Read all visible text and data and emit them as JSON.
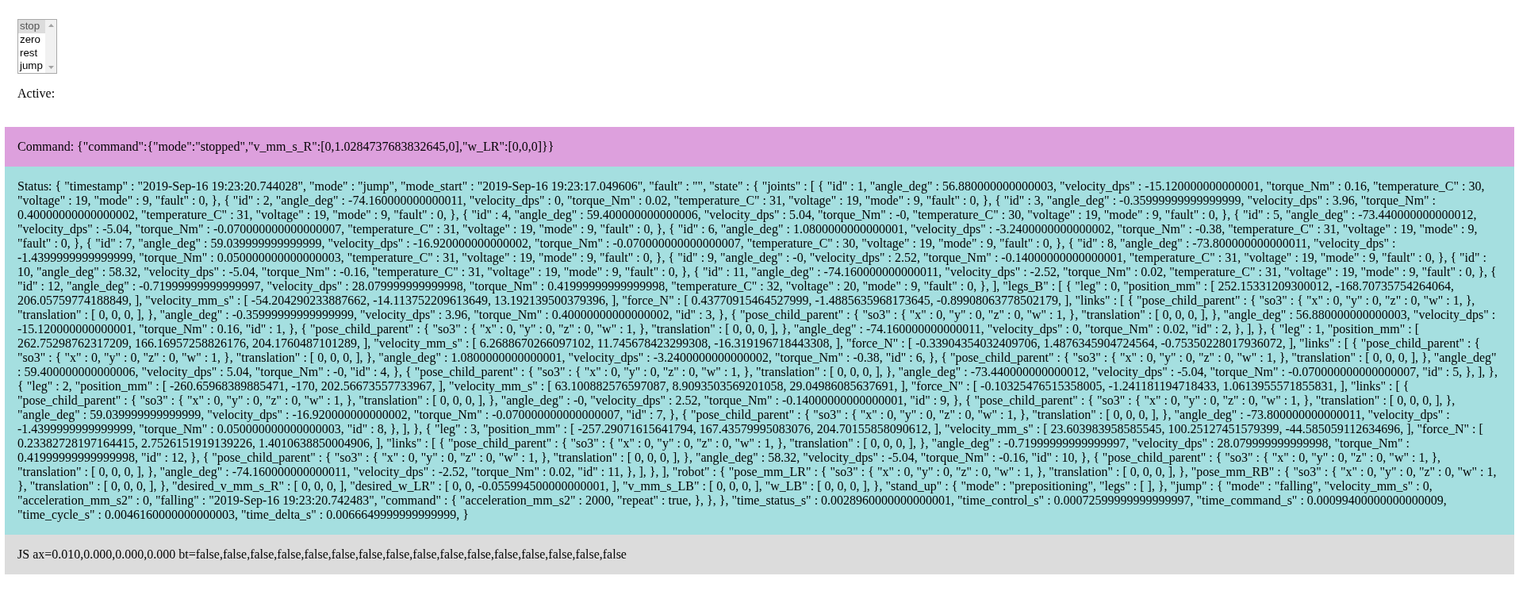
{
  "select": {
    "options": [
      {
        "label": "stop",
        "selected": true
      },
      {
        "label": "zero",
        "selected": false
      },
      {
        "label": "rest",
        "selected": false
      },
      {
        "label": "jump",
        "selected": false
      }
    ]
  },
  "active": {
    "label": "Active:"
  },
  "command_panel": {
    "text": "Command: {\"command\":{\"mode\":\"stopped\",\"v_mm_s_R\":[0,1.0284737683832645,0],\"w_LR\":[0,0,0]}}"
  },
  "status_panel": {
    "text": "Status: { \"timestamp\" : \"2019-Sep-16 19:23:20.744028\", \"mode\" : \"jump\", \"mode_start\" : \"2019-Sep-16 19:23:17.049606\", \"fault\" : \"\", \"state\" : { \"joints\" : [ { \"id\" : 1, \"angle_deg\" : 56.880000000000003, \"velocity_dps\" : -15.120000000000001, \"torque_Nm\" : 0.16, \"temperature_C\" : 30, \"voltage\" : 19, \"mode\" : 9, \"fault\" : 0, }, { \"id\" : 2, \"angle_deg\" : -74.160000000000011, \"velocity_dps\" : 0, \"torque_Nm\" : 0.02, \"temperature_C\" : 31, \"voltage\" : 19, \"mode\" : 9, \"fault\" : 0, }, { \"id\" : 3, \"angle_deg\" : -0.35999999999999999, \"velocity_dps\" : 3.96, \"torque_Nm\" : 0.40000000000000002, \"temperature_C\" : 31, \"voltage\" : 19, \"mode\" : 9, \"fault\" : 0, }, { \"id\" : 4, \"angle_deg\" : 59.400000000000006, \"velocity_dps\" : 5.04, \"torque_Nm\" : -0, \"temperature_C\" : 30, \"voltage\" : 19, \"mode\" : 9, \"fault\" : 0, }, { \"id\" : 5, \"angle_deg\" : -73.440000000000012, \"velocity_dps\" : -5.04, \"torque_Nm\" : -0.070000000000000007, \"temperature_C\" : 31, \"voltage\" : 19, \"mode\" : 9, \"fault\" : 0, }, { \"id\" : 6, \"angle_deg\" : 1.0800000000000001, \"velocity_dps\" : -3.2400000000000002, \"torque_Nm\" : -0.38, \"temperature_C\" : 31, \"voltage\" : 19, \"mode\" : 9, \"fault\" : 0, }, { \"id\" : 7, \"angle_deg\" : 59.039999999999999, \"velocity_dps\" : -16.920000000000002, \"torque_Nm\" : -0.070000000000000007, \"temperature_C\" : 30, \"voltage\" : 19, \"mode\" : 9, \"fault\" : 0, }, { \"id\" : 8, \"angle_deg\" : -73.800000000000011, \"velocity_dps\" : -1.4399999999999999, \"torque_Nm\" : 0.050000000000000003, \"temperature_C\" : 31, \"voltage\" : 19, \"mode\" : 9, \"fault\" : 0, }, { \"id\" : 9, \"angle_deg\" : -0, \"velocity_dps\" : 2.52, \"torque_Nm\" : -0.14000000000000001, \"temperature_C\" : 31, \"voltage\" : 19, \"mode\" : 9, \"fault\" : 0, }, { \"id\" : 10, \"angle_deg\" : 58.32, \"velocity_dps\" : -5.04, \"torque_Nm\" : -0.16, \"temperature_C\" : 31, \"voltage\" : 19, \"mode\" : 9, \"fault\" : 0, }, { \"id\" : 11, \"angle_deg\" : -74.160000000000011, \"velocity_dps\" : -2.52, \"torque_Nm\" : 0.02, \"temperature_C\" : 31, \"voltage\" : 19, \"mode\" : 9, \"fault\" : 0, }, { \"id\" : 12, \"angle_deg\" : -0.71999999999999997, \"velocity_dps\" : 28.079999999999998, \"torque_Nm\" : 0.41999999999999998, \"temperature_C\" : 32, \"voltage\" : 20, \"mode\" : 9, \"fault\" : 0, }, ], \"legs_B\" : [ { \"leg\" : 0, \"position_mm\" : [ 252.15331209300012, -168.70735754264064, 206.05759774188849, ], \"velocity_mm_s\" : [ -54.204290233887662, -14.113752209613649, 13.192139500379396, ], \"force_N\" : [ 0.43770915464527999, -1.4885635968173645, -0.89908063778502179, ], \"links\" : [ { \"pose_child_parent\" : { \"so3\" : { \"x\" : 0, \"y\" : 0, \"z\" : 0, \"w\" : 1, }, \"translation\" : [ 0, 0, 0, ], }, \"angle_deg\" : -0.35999999999999999, \"velocity_dps\" : 3.96, \"torque_Nm\" : 0.40000000000000002, \"id\" : 3, }, { \"pose_child_parent\" : { \"so3\" : { \"x\" : 0, \"y\" : 0, \"z\" : 0, \"w\" : 1, }, \"translation\" : [ 0, 0, 0, ], }, \"angle_deg\" : 56.880000000000003, \"velocity_dps\" : -15.120000000000001, \"torque_Nm\" : 0.16, \"id\" : 1, }, { \"pose_child_parent\" : { \"so3\" : { \"x\" : 0, \"y\" : 0, \"z\" : 0, \"w\" : 1, }, \"translation\" : [ 0, 0, 0, ], }, \"angle_deg\" : -74.160000000000011, \"velocity_dps\" : 0, \"torque_Nm\" : 0.02, \"id\" : 2, }, ], }, { \"leg\" : 1, \"position_mm\" : [ 262.75298762317209, 166.16957258826176, 204.1760487101289, ], \"velocity_mm_s\" : [ 6.2688670266097102, 11.745678423299308, -16.319196718443308, ], \"force_N\" : [ -0.33904354032409706, 1.4876345904724564, -0.75350228017936072, ], \"links\" : [ { \"pose_child_parent\" : { \"so3\" : { \"x\" : 0, \"y\" : 0, \"z\" : 0, \"w\" : 1, }, \"translation\" : [ 0, 0, 0, ], }, \"angle_deg\" : 1.0800000000000001, \"velocity_dps\" : -3.2400000000000002, \"torque_Nm\" : -0.38, \"id\" : 6, }, { \"pose_child_parent\" : { \"so3\" : { \"x\" : 0, \"y\" : 0, \"z\" : 0, \"w\" : 1, }, \"translation\" : [ 0, 0, 0, ], }, \"angle_deg\" : 59.400000000000006, \"velocity_dps\" : 5.04, \"torque_Nm\" : -0, \"id\" : 4, }, { \"pose_child_parent\" : { \"so3\" : { \"x\" : 0, \"y\" : 0, \"z\" : 0, \"w\" : 1, }, \"translation\" : [ 0, 0, 0, ], }, \"angle_deg\" : -73.440000000000012, \"velocity_dps\" : -5.04, \"torque_Nm\" : -0.070000000000000007, \"id\" : 5, }, ], }, { \"leg\" : 2, \"position_mm\" : [ -260.65968389885471, -170, 202.56673557733967, ], \"velocity_mm_s\" : [ 63.100882576597087, 8.9093503569201058, 29.04986085637691, ], \"force_N\" : [ -0.10325476515358005, -1.241181194718433, 1.0613955571855831, ], \"links\" : [ { \"pose_child_parent\" : { \"so3\" : { \"x\" : 0, \"y\" : 0, \"z\" : 0, \"w\" : 1, }, \"translation\" : [ 0, 0, 0, ], }, \"angle_deg\" : -0, \"velocity_dps\" : 2.52, \"torque_Nm\" : -0.14000000000000001, \"id\" : 9, }, { \"pose_child_parent\" : { \"so3\" : { \"x\" : 0, \"y\" : 0, \"z\" : 0, \"w\" : 1, }, \"translation\" : [ 0, 0, 0, ], }, \"angle_deg\" : 59.039999999999999, \"velocity_dps\" : -16.920000000000002, \"torque_Nm\" : -0.070000000000000007, \"id\" : 7, }, { \"pose_child_parent\" : { \"so3\" : { \"x\" : 0, \"y\" : 0, \"z\" : 0, \"w\" : 1, }, \"translation\" : [ 0, 0, 0, ], }, \"angle_deg\" : -73.800000000000011, \"velocity_dps\" : -1.4399999999999999, \"torque_Nm\" : 0.050000000000000003, \"id\" : 8, }, ], }, { \"leg\" : 3, \"position_mm\" : [ -257.29071615641794, 167.43579995083076, 204.70155858090612, ], \"velocity_mm_s\" : [ 23.603983958585545, 100.25127451579399, -44.585059112634696, ], \"force_N\" : [ 0.23382728197164415, 2.7526151919139226, 1.4010638850004906, ], \"links\" : [ { \"pose_child_parent\" : { \"so3\" : { \"x\" : 0, \"y\" : 0, \"z\" : 0, \"w\" : 1, }, \"translation\" : [ 0, 0, 0, ], }, \"angle_deg\" : -0.71999999999999997, \"velocity_dps\" : 28.079999999999998, \"torque_Nm\" : 0.41999999999999998, \"id\" : 12, }, { \"pose_child_parent\" : { \"so3\" : { \"x\" : 0, \"y\" : 0, \"z\" : 0, \"w\" : 1, }, \"translation\" : [ 0, 0, 0, ], }, \"angle_deg\" : 58.32, \"velocity_dps\" : -5.04, \"torque_Nm\" : -0.16, \"id\" : 10, }, { \"pose_child_parent\" : { \"so3\" : { \"x\" : 0, \"y\" : 0, \"z\" : 0, \"w\" : 1, }, \"translation\" : [ 0, 0, 0, ], }, \"angle_deg\" : -74.160000000000011, \"velocity_dps\" : -2.52, \"torque_Nm\" : 0.02, \"id\" : 11, }, ], }, ], \"robot\" : { \"pose_mm_LR\" : { \"so3\" : { \"x\" : 0, \"y\" : 0, \"z\" : 0, \"w\" : 1, }, \"translation\" : [ 0, 0, 0, ], }, \"pose_mm_RB\" : { \"so3\" : { \"x\" : 0, \"y\" : 0, \"z\" : 0, \"w\" : 1, }, \"translation\" : [ 0, 0, 0, ], }, \"desired_v_mm_s_R\" : [ 0, 0, 0, ], \"desired_w_LR\" : [ 0, 0, -0.055994500000000001, ], \"v_mm_s_LB\" : [ 0, 0, 0, ], \"w_LB\" : [ 0, 0, 0, ], }, \"stand_up\" : { \"mode\" : \"prepositioning\", \"legs\" : [ ], }, \"jump\" : { \"mode\" : \"falling\", \"velocity_mm_s\" : 0, \"acceleration_mm_s2\" : 0, \"falling\" : \"2019-Sep-16 19:23:20.742483\", \"command\" : { \"acceleration_mm_s2\" : 2000, \"repeat\" : true, }, }, }, \"time_status_s\" : 0.0028960000000000001, \"time_control_s\" : 0.00072599999999999997, \"time_command_s\" : 0.00099400000000000009, \"time_cycle_s\" : 0.0046160000000000003, \"time_delta_s\" : 0.0066649999999999999, }"
  },
  "js_panel": {
    "text": "JS ax=0.010,0.000,0.000,0.000 bt=false,false,false,false,false,false,false,false,false,false,false,false,false,false,false,false"
  }
}
